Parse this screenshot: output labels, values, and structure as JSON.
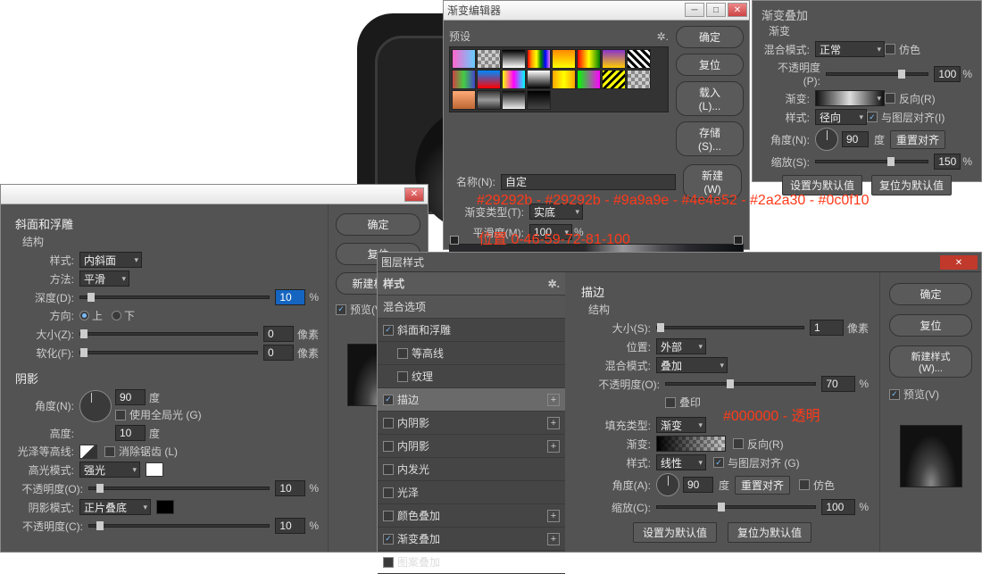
{
  "bg_annotations": {
    "colors": "#29292b - #29292b - #9a9a9e - #4e4e52 - #2a2a30 - #0c0f10",
    "positions": "位置 0-46-59-72-81-100",
    "stroke_colors": "#000000 - 透明"
  },
  "gradient_editor": {
    "title": "渐变编辑器",
    "presets_label": "预设",
    "buttons": {
      "ok": "确定",
      "reset": "复位",
      "load": "载入(L)...",
      "save": "存储(S)...",
      "new": "新建(W)"
    },
    "name_label": "名称(N):",
    "name_value": "自定",
    "grad_type_label": "渐变类型(T):",
    "grad_type_value": "实底",
    "smooth_label": "平滑度(M):",
    "smooth_value": "100",
    "smooth_unit": "%"
  },
  "grad_overlay": {
    "title": "渐变叠加",
    "sub": "渐变",
    "blend_label": "混合模式:",
    "blend_value": "正常",
    "dither_label": "仿色",
    "opacity_label": "不透明度(P):",
    "opacity_value": "100",
    "opacity_unit": "%",
    "grad_label": "渐变:",
    "reverse_label": "反向(R)",
    "style_label": "样式:",
    "style_value": "径向",
    "align_label": "与图层对齐(I)",
    "angle_label": "角度(N):",
    "angle_value": "90",
    "angle_unit": "度",
    "reset_align": "重置对齐",
    "scale_label": "缩放(S):",
    "scale_value": "150",
    "scale_unit": "%",
    "default_btn": "设置为默认值",
    "reset_btn": "复位为默认值"
  },
  "bevel_dialog": {
    "title": "斜面和浮雕",
    "struct": "结构",
    "style_label": "样式:",
    "style_value": "内斜面",
    "method_label": "方法:",
    "method_value": "平滑",
    "depth_label": "深度(D):",
    "depth_value": "10",
    "depth_unit": "%",
    "dir_label": "方向:",
    "dir_up": "上",
    "dir_down": "下",
    "size_label": "大小(Z):",
    "size_value": "0",
    "size_unit": "像素",
    "soften_label": "软化(F):",
    "soften_value": "0",
    "soften_unit": "像素",
    "shadow_title": "阴影",
    "angle_label": "角度(N):",
    "angle_value": "90",
    "angle_unit": "度",
    "global_label": "使用全局光 (G)",
    "alt_label": "高度:",
    "alt_value": "10",
    "alt_unit": "度",
    "gloss_label": "光泽等高线:",
    "anti_label": "消除锯齿 (L)",
    "hl_mode_label": "高光模式:",
    "hl_mode_value": "强光",
    "opacity1_label": "不透明度(O):",
    "opacity1_value": "10",
    "opacity1_unit": "%",
    "sh_mode_label": "阴影模式:",
    "sh_mode_value": "正片叠底",
    "opacity2_label": "不透明度(C):",
    "opacity2_value": "10",
    "opacity2_unit": "%",
    "buttons": {
      "ok": "确定",
      "reset": "复位",
      "new_style": "新建样式...",
      "preview": "预览(V)"
    }
  },
  "layer_style": {
    "title": "图层样式",
    "col_header": "样式",
    "blend_opts": "混合选项",
    "items": [
      {
        "label": "斜面和浮雕",
        "checked": true
      },
      {
        "label": "等高线",
        "checked": false,
        "sub": true
      },
      {
        "label": "纹理",
        "checked": false,
        "sub": true
      },
      {
        "label": "描边",
        "checked": true,
        "selected": true,
        "plus": true
      },
      {
        "label": "内阴影",
        "checked": false,
        "plus": true
      },
      {
        "label": "内阴影",
        "checked": false,
        "plus": true
      },
      {
        "label": "内发光",
        "checked": false
      },
      {
        "label": "光泽",
        "checked": false
      },
      {
        "label": "颜色叠加",
        "checked": false,
        "plus": true
      },
      {
        "label": "渐变叠加",
        "checked": true,
        "plus": true
      },
      {
        "label": "图案叠加",
        "checked": false
      }
    ],
    "stroke": {
      "title": "描边",
      "struct": "结构",
      "size_label": "大小(S):",
      "size_value": "1",
      "size_unit": "像素",
      "pos_label": "位置:",
      "pos_value": "外部",
      "blend_label": "混合模式:",
      "blend_value": "叠加",
      "opacity_label": "不透明度(O):",
      "opacity_value": "70",
      "opacity_unit": "%",
      "overprint_label": "叠印",
      "fill_label": "填充类型:",
      "fill_value": "渐变",
      "grad_label": "渐变:",
      "reverse_label": "反向(R)",
      "style_label": "样式:",
      "style_value": "线性",
      "align_label": "与图层对齐 (G)",
      "angle_label": "角度(A):",
      "angle_value": "90",
      "angle_unit": "度",
      "reset_align": "重置对齐",
      "dither_label": "仿色",
      "scale_label": "缩放(C):",
      "scale_value": "100",
      "scale_unit": "%",
      "default_btn": "设置为默认值",
      "reset_btn": "复位为默认值"
    },
    "buttons": {
      "ok": "确定",
      "reset": "复位",
      "new_style": "新建样式 (W)...",
      "preview": "预览(V)"
    }
  }
}
